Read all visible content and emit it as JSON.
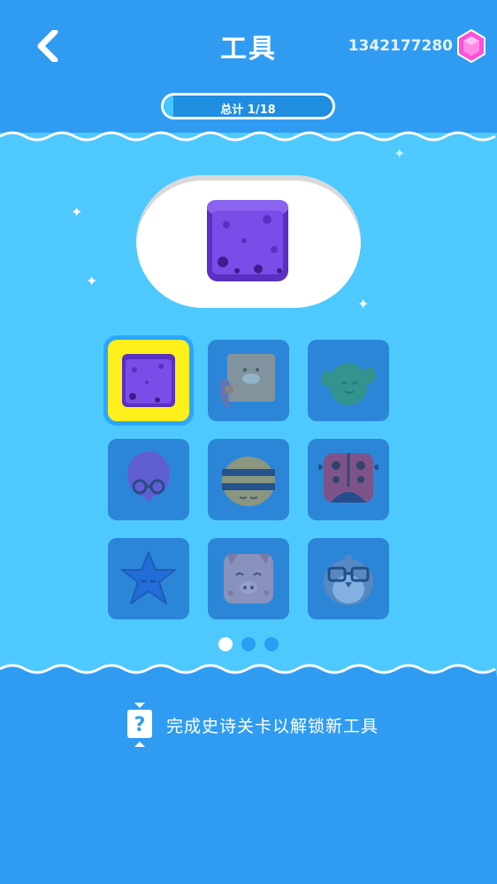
{
  "header": {
    "title": "工具",
    "gem_count": "1342177280",
    "total_label": "总计 1/18",
    "progress": 0.0556
  },
  "preview": {
    "item": "purple-sponge-block"
  },
  "grid": {
    "items": [
      {
        "name": "purple-sponge-block",
        "selected": true,
        "locked": false
      },
      {
        "name": "biscuit-dog-block",
        "selected": false,
        "locked": true
      },
      {
        "name": "cactus-block",
        "selected": false,
        "locked": true
      },
      {
        "name": "purple-balloon-glasses",
        "selected": false,
        "locked": true
      },
      {
        "name": "bee-block",
        "selected": false,
        "locked": true
      },
      {
        "name": "ladybug-block",
        "selected": false,
        "locked": true
      },
      {
        "name": "blue-star",
        "selected": false,
        "locked": true
      },
      {
        "name": "pig-block",
        "selected": false,
        "locked": true
      },
      {
        "name": "penguin-glasses",
        "selected": false,
        "locked": true
      }
    ]
  },
  "pager": {
    "pages": 3,
    "active": 0
  },
  "footer": {
    "hint_text": "完成史诗关卡以解锁新工具",
    "hint_icon": "question-hourglass-icon"
  },
  "colors": {
    "background": "#2f9cf2",
    "band": "#4ec9fd",
    "selected": "#ffef1a",
    "gem": "#ff4fd8",
    "cell": "#2c86d8"
  }
}
